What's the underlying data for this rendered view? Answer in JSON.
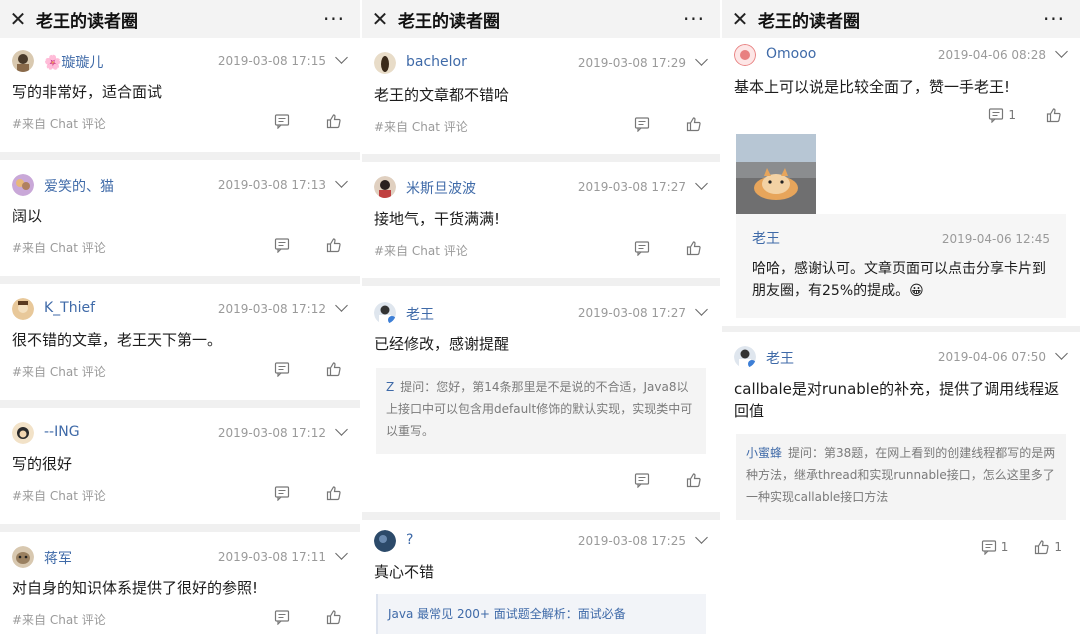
{
  "title": "老王的读者圈",
  "source_label": "#来自 Chat 评论",
  "panel1": [
    {
      "name": "🌸璇璇儿",
      "time": "2019-03-08 17:15",
      "text": "写的非常好，适合面试"
    },
    {
      "name": "爱笑的、猫",
      "time": "2019-03-08 17:13",
      "text": "阔以"
    },
    {
      "name": "K_Thief",
      "time": "2019-03-08 17:12",
      "text": "很不错的文章，老王天下第一。"
    },
    {
      "name": "--ING",
      "time": "2019-03-08 17:12",
      "text": "写的很好"
    },
    {
      "name": "蒋军",
      "time": "2019-03-08 17:11",
      "text": "对自身的知识体系提供了很好的参照!"
    }
  ],
  "panel2": {
    "c1": {
      "name": "bachelor",
      "time": "2019-03-08 17:29",
      "text": "老王的文章都不错哈"
    },
    "c2": {
      "name": "米斯旦波波",
      "time": "2019-03-08 17:27",
      "text": "接地气，干货满满!"
    },
    "c3": {
      "name": "老王",
      "time": "2019-03-08 17:27",
      "text": "已经修改，感谢提醒",
      "quote_name": "Z",
      "quote_text": "提问：您好，第14条那里是不是说的不合适，Java8以上接口中可以包含用default修饰的默认实现，实现类中可以重写。"
    },
    "c4": {
      "name": "?",
      "time": "2019-03-08 17:25",
      "text": "真心不错",
      "link_text": "Java 最常见 200+ 面试题全解析：面试必备"
    }
  },
  "panel3": {
    "c1": {
      "name": "Omooo",
      "time": "2019-04-06 08:28",
      "text": "基本上可以说是比较全面了，赞一手老王!",
      "comment_count": "1",
      "reply_name": "老王",
      "reply_time": "2019-04-06 12:45",
      "reply_text": "哈哈，感谢认可。文章页面可以点击分享卡片到朋友圈，有25%的提成。😀"
    },
    "c2": {
      "name": "老王",
      "time": "2019-04-06 07:50",
      "text": "callbale是对runable的补充，提供了调用线程返回值",
      "quote_name": "小蜜蜂",
      "quote_text": "提问：第38题，在网上看到的创建线程都写的是两种方法，继承thread和实现runnable接口，怎么这里多了一种实现callable接口方法",
      "comment_count": "1",
      "like_count": "1"
    }
  },
  "icons": [
    "close-icon",
    "more-icon",
    "chevron-down-icon",
    "comment-icon",
    "thumb-up-icon"
  ],
  "colors": {
    "username": "#3f6aa8",
    "topbar": "#f3f3f3",
    "divider": "#f0f0f0"
  }
}
